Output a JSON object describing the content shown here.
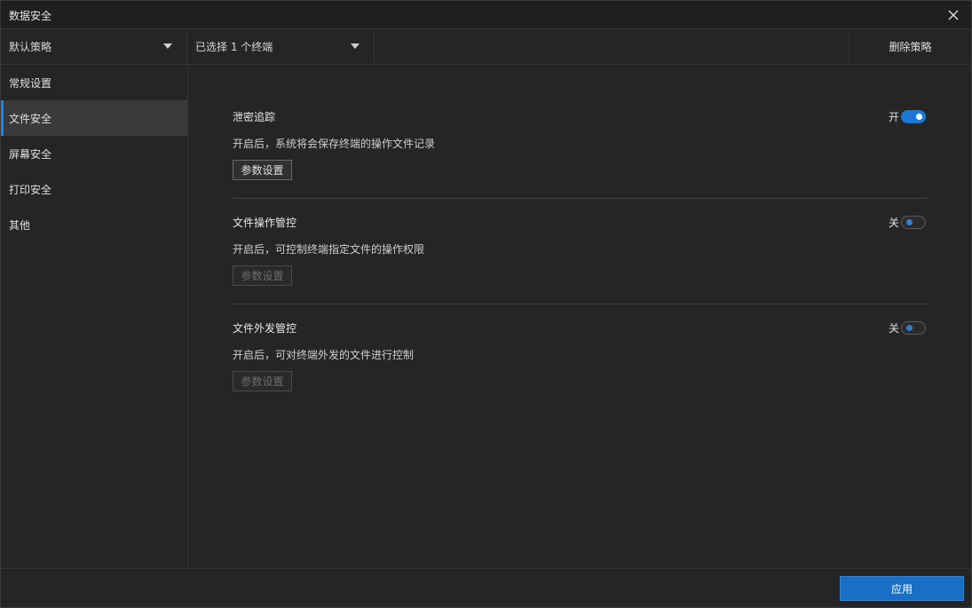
{
  "window": {
    "title": "数据安全"
  },
  "toolbar": {
    "policy_dropdown": "默认策略",
    "terminal_dropdown": "已选择 1 个终端",
    "delete_label": "删除策略"
  },
  "sidebar": {
    "items": [
      {
        "label": "常规设置",
        "active": false
      },
      {
        "label": "文件安全",
        "active": true
      },
      {
        "label": "屏幕安全",
        "active": false
      },
      {
        "label": "打印安全",
        "active": false
      },
      {
        "label": "其他",
        "active": false
      }
    ]
  },
  "main": {
    "sections": [
      {
        "title": "泄密追踪",
        "description": "开启后，系统将会保存终端的操作文件记录",
        "toggle_label": "开",
        "enabled": true,
        "param_label": "参数设置"
      },
      {
        "title": "文件操作管控",
        "description": "开启后，可控制终端指定文件的操作权限",
        "toggle_label": "关",
        "enabled": false,
        "param_label": "参数设置"
      },
      {
        "title": "文件外发管控",
        "description": "开启后，可对终端外发的文件进行控制",
        "toggle_label": "关",
        "enabled": false,
        "param_label": "参数设置"
      }
    ]
  },
  "footer": {
    "apply_label": "应用"
  },
  "colors": {
    "accent": "#1a79d6",
    "background": "#252525",
    "active_item": "#3a3a3a"
  },
  "icons": {
    "close": "close-icon",
    "dropdown": "chevron-down-icon"
  }
}
